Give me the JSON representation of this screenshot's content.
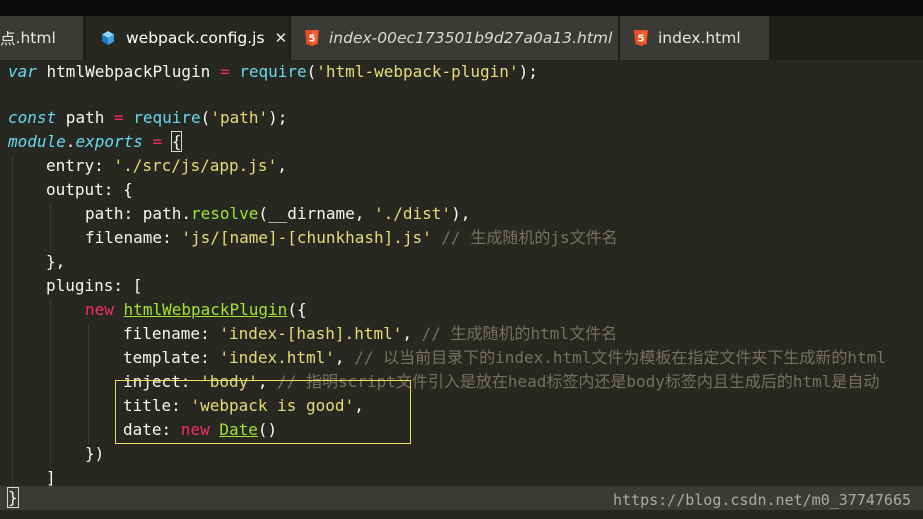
{
  "tabs": [
    {
      "label": ".html",
      "icon": "none",
      "active": false,
      "preview": false
    },
    {
      "label": "webpack.config.js",
      "icon": "cube-icon",
      "active": true,
      "preview": false,
      "close": "✕"
    },
    {
      "label": "index-00ec173501b9d27a0a13.html",
      "icon": "html5-icon",
      "active": false,
      "preview": true
    },
    {
      "label": "index.html",
      "icon": "html5-icon",
      "active": false,
      "preview": false
    }
  ],
  "tab_first_prefix": "点",
  "code": {
    "l1_kw": "var",
    "l1_name": " htmlWebpackPlugin ",
    "l1_eq": "=",
    "l1_fn": " require",
    "l1_open": "(",
    "l1_str": "'html-webpack-plugin'",
    "l1_close": ");",
    "l3_kw": "const",
    "l3_name": " path ",
    "l3_eq": "=",
    "l3_fn": " require",
    "l3_open": "(",
    "l3_str": "'path'",
    "l3_close": ");",
    "l4_kw": "module",
    "l4_dot": ".",
    "l4_prop": "exports",
    "l4_eq": " = ",
    "l4_brace": "{",
    "l5_key": "entry: ",
    "l5_str": "'./src/js/app.js'",
    "l5_end": ",",
    "l6_key": "output: {",
    "l7_key": "path: path.",
    "l7_fn": "resolve",
    "l7_args1": "(__dirname, ",
    "l7_str": "'./dist'",
    "l7_end": "),",
    "l8_key": "filename: ",
    "l8_str": "'js/[name]-[chunkhash].js'",
    "l8_cmt": " // 生成随机的js文件名",
    "l9": "},",
    "l10": "plugins: [",
    "l11_kw": "new",
    "l11_cls": "htmlWebpackPlugin",
    "l11_end": "({",
    "l12_key": "filename: ",
    "l12_str": "'index-[hash].html'",
    "l12_comma": ",",
    "l12_cmt": " // 生成随机的html文件名",
    "l13_key": "template: ",
    "l13_str": "'index.html'",
    "l13_comma": ",",
    "l13_cmt": " // 以当前目录下的index.html文件为模板在指定文件夹下生成新的html",
    "l14_key": "inject: ",
    "l14_str": "'body'",
    "l14_comma": ",",
    "l14_cmt": " // 指明script文件引入是放在head标签内还是body标签内且生成后的html是自动",
    "l15_key": "title: ",
    "l15_str": "'webpack is good'",
    "l15_comma": ",",
    "l16_key": "date: ",
    "l16_kw": "new",
    "l16_cls": "Date",
    "l16_end": "()",
    "l17": "})",
    "l18": "]",
    "l19": "}"
  },
  "watermark": "https://blog.csdn.net/m0_37747665",
  "colors": {
    "background": "#272822",
    "tab_bar": "#1e1f1a",
    "tab_inactive": "#3a3b36",
    "keyword": "#f92672",
    "storage": "#66d9ef",
    "string": "#e6db74",
    "comment": "#75715e",
    "class": "#a6e22e",
    "annotation_box": "#e8e060"
  }
}
